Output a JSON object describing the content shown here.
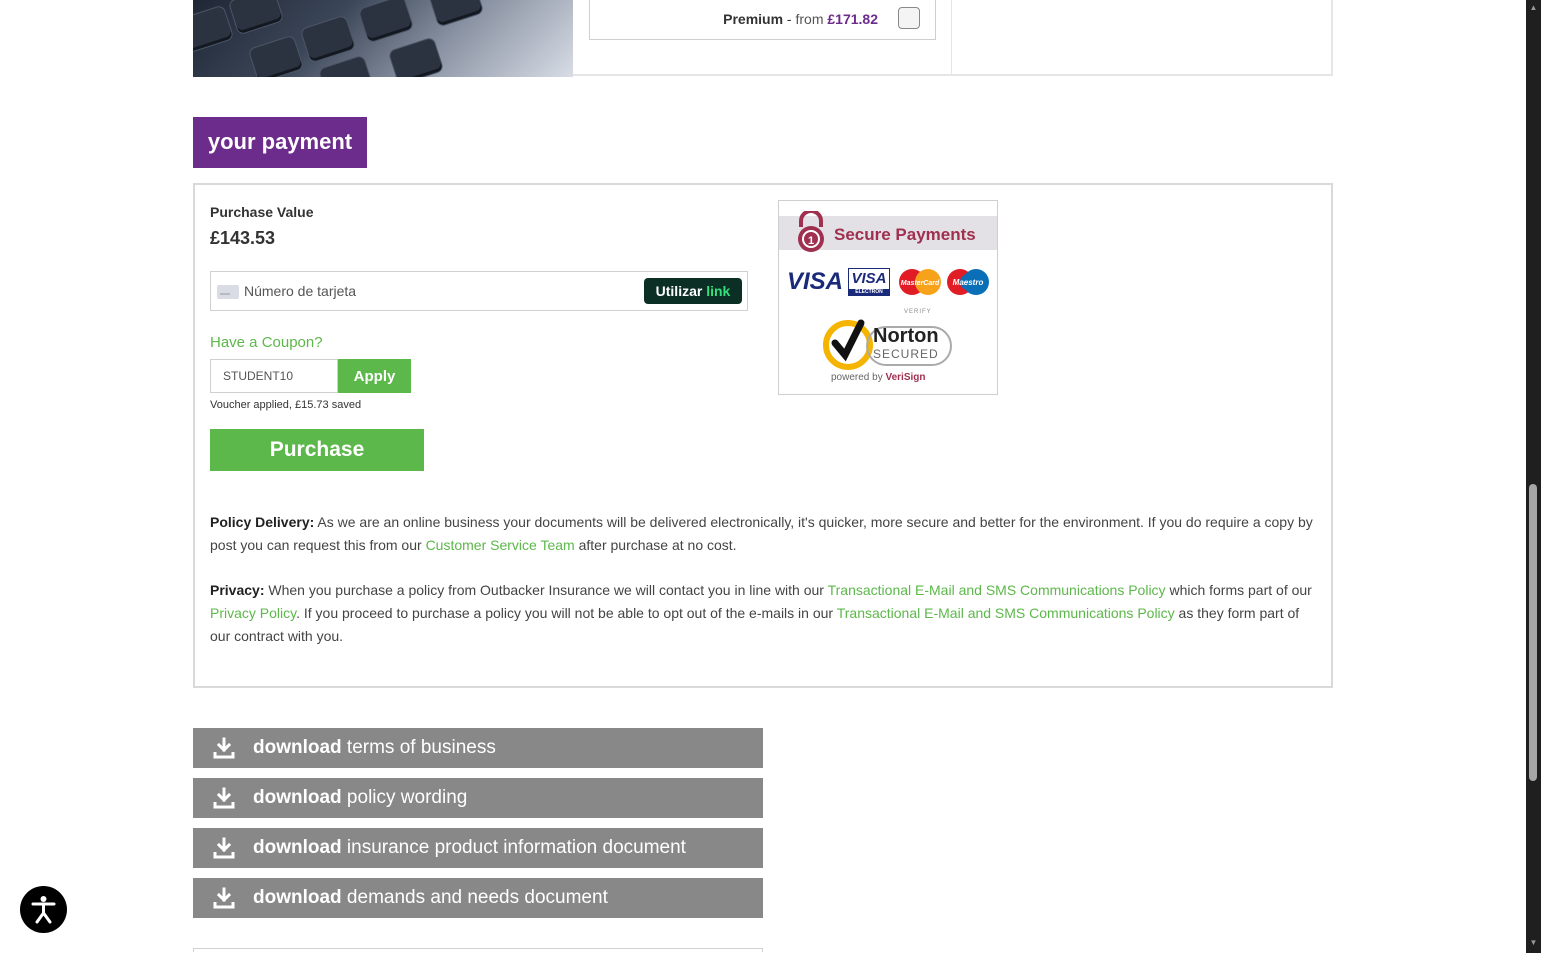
{
  "top": {
    "premium_label": "Premium",
    "premium_sep": " - ",
    "premium_from": "from",
    "premium_price": "£171.82"
  },
  "payment": {
    "heading": "your payment",
    "purchase_value_label": "Purchase Value",
    "purchase_value": "£143.53",
    "card_placeholder": "Número de tarjeta",
    "link_button_prefix": "Utilizar",
    "link_button_brand": "link",
    "coupon_link": "Have a Coupon?",
    "coupon_value": "STUDENT10",
    "apply_label": "Apply",
    "voucher_message": "Voucher applied, £15.73 saved",
    "purchase_label": "Purchase"
  },
  "secure_badge": {
    "title": "Secure Payments",
    "visa": "VISA",
    "visa_electron": "VISA",
    "visa_electron_sub": "ELECTRON",
    "mastercard": "MasterCard",
    "maestro": "Maestro",
    "verify": "VERIFY",
    "norton_name": "Norton",
    "norton_secured": "SECURED",
    "powered_by": "powered by",
    "verisign": "VeriSign"
  },
  "policy_delivery": {
    "label": "Policy Delivery:",
    "text1": " As we are an online business your documents will be delivered electronically, it's quicker, more secure and better for the environment. If you do require a copy by post you can request this from our ",
    "link": "Customer Service Team",
    "text2": " after purchase at no cost."
  },
  "privacy": {
    "label": "Privacy:",
    "text1": " When you purchase a policy from Outbacker Insurance we will contact you in line with our ",
    "link1": "Transactional E-Mail and SMS Communications Policy",
    "text2": " which forms part of our ",
    "link2": "Privacy Policy",
    "text3": ". If you proceed to purchase a policy you will not be able to opt out of the e-mails in our ",
    "link3": "Transactional E-Mail and SMS Communications Policy",
    "text4": " as they form part of our contract with you."
  },
  "downloads": [
    {
      "bold": "download",
      "rest": " terms of business"
    },
    {
      "bold": "download",
      "rest": " policy wording"
    },
    {
      "bold": "download",
      "rest": " insurance product information document"
    },
    {
      "bold": "download",
      "rest": " demands and needs document"
    }
  ],
  "colors": {
    "brand_purple": "#6c2c8c",
    "action_green": "#5cb84a",
    "download_grey": "#888888",
    "secure_red": "#a03050"
  },
  "icons": {
    "download": "download-icon",
    "lock": "padlock-icon",
    "accessibility": "accessibility-icon",
    "card": "credit-card-icon"
  }
}
